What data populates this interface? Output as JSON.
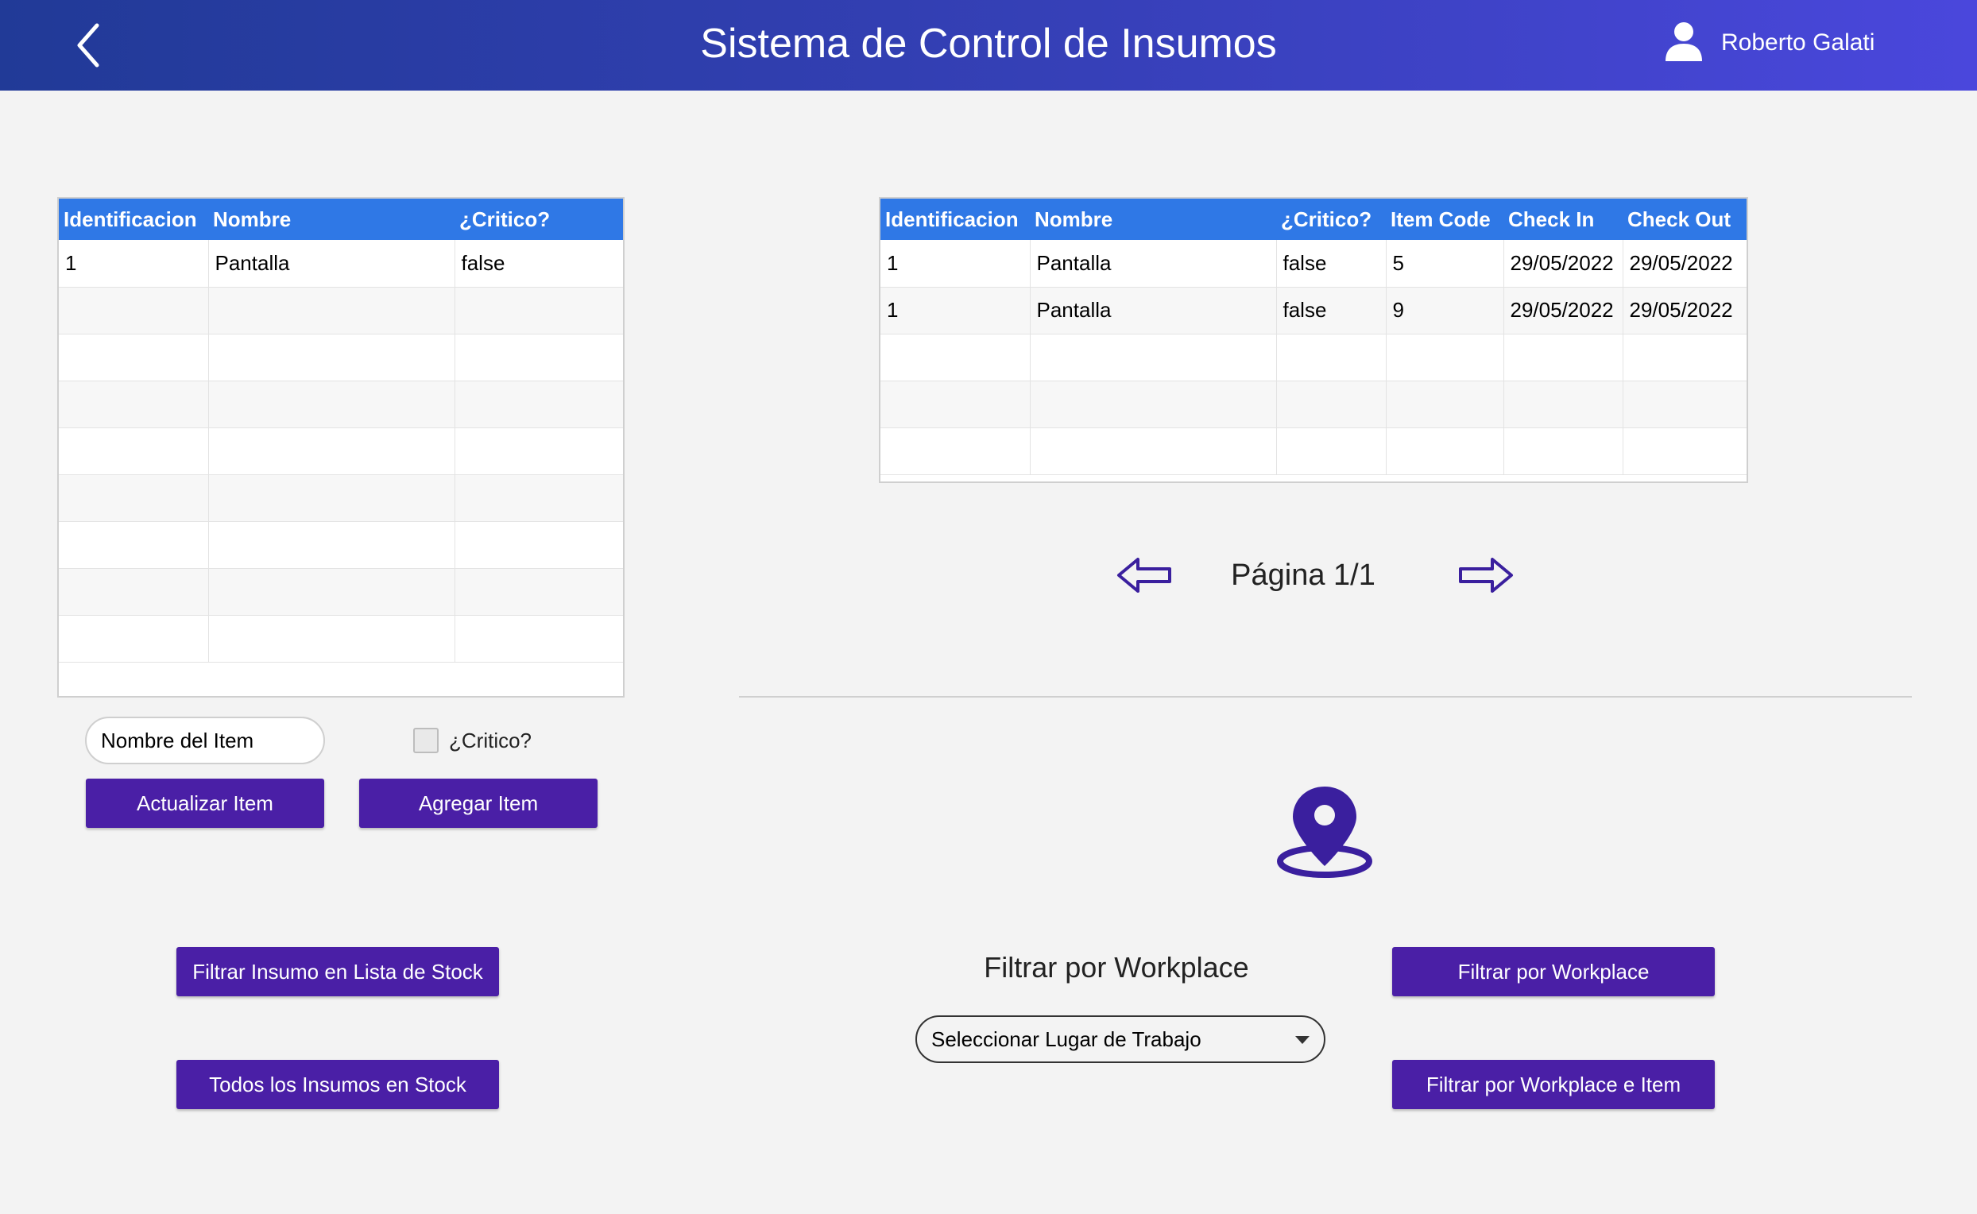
{
  "header": {
    "title": "Sistema de Control de Insumos",
    "user_name": "Roberto Galati",
    "back_icon": "chevron-left-icon",
    "user_icon": "user-icon"
  },
  "colors": {
    "accent": "#4a1fa6",
    "table_header": "#2f78e6",
    "header_gradient_start": "#213a97",
    "header_gradient_end": "#4a47dc"
  },
  "stock_table": {
    "columns": [
      "Identificacion",
      "Nombre",
      "¿Critico?"
    ],
    "rows": [
      [
        "1",
        "Pantalla",
        "false"
      ],
      [
        "",
        "",
        ""
      ],
      [
        "",
        "",
        ""
      ],
      [
        "",
        "",
        ""
      ],
      [
        "",
        "",
        ""
      ],
      [
        "",
        "",
        ""
      ],
      [
        "",
        "",
        ""
      ],
      [
        "",
        "",
        ""
      ],
      [
        "",
        "",
        ""
      ]
    ]
  },
  "workplace_table": {
    "columns": [
      "Identificacion",
      "Nombre",
      "¿Critico?",
      "Item Code",
      "Check In",
      "Check Out"
    ],
    "rows": [
      [
        "1",
        "Pantalla",
        "false",
        "5",
        "29/05/2022",
        "29/05/2022"
      ],
      [
        "1",
        "Pantalla",
        "false",
        "9",
        "29/05/2022",
        "29/05/2022"
      ],
      [
        "",
        "",
        "",
        "",
        "",
        ""
      ],
      [
        "",
        "",
        "",
        "",
        "",
        ""
      ],
      [
        "",
        "",
        "",
        "",
        "",
        ""
      ]
    ]
  },
  "pager": {
    "label": "Página 1/1",
    "prev_icon": "arrow-left-icon",
    "next_icon": "arrow-right-icon"
  },
  "item_form": {
    "name_value": "Nombre del Item",
    "critico_label": "¿Critico?",
    "critico_checked": false,
    "update_label": "Actualizar Item",
    "add_label": "Agregar Item"
  },
  "stock_actions": {
    "filter_label": "Filtrar Insumo en Lista de Stock",
    "all_label": "Todos los Insumos en Stock"
  },
  "workplace_filter": {
    "icon": "location-pin-icon",
    "title": "Filtrar por Workplace",
    "select_value": "Seleccionar Lugar de Trabajo",
    "filter_button": "Filtrar por Workplace",
    "filter_item_button": "Filtrar por Workplace e Item"
  }
}
